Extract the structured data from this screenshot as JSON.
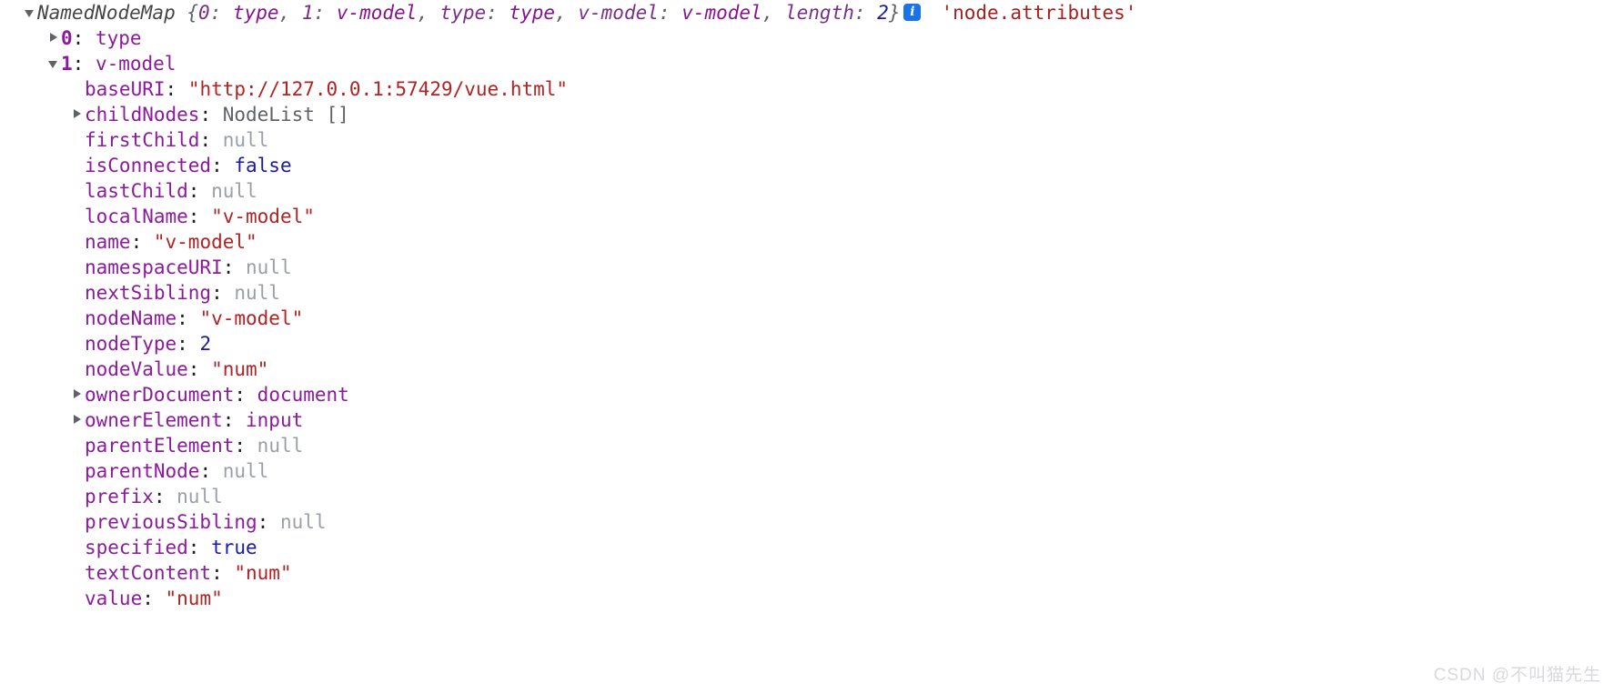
{
  "console": {
    "header": {
      "arrow": "triangle-down",
      "class_name": "NamedNodeMap",
      "brace_open": "{",
      "entries": [
        {
          "key": "0",
          "sep": ": ",
          "value": "type"
        },
        {
          "key": "1",
          "sep": ": ",
          "value": "v-model"
        },
        {
          "key": "type",
          "sep": ": ",
          "value": "type"
        },
        {
          "key": "v-model",
          "sep": ": ",
          "value": "v-model"
        },
        {
          "key": "length",
          "sep": ": ",
          "value": "2",
          "value_type": "number"
        }
      ],
      "brace_close": "}",
      "info_icon": "info-icon",
      "info_glyph": "i",
      "source_label": "'node.attributes'"
    },
    "children": [
      {
        "arrow": "triangle-right",
        "indent": 1,
        "key": "0",
        "key_bold": true,
        "value": "type",
        "value_type": "object"
      },
      {
        "arrow": "triangle-down",
        "indent": 1,
        "key": "1",
        "key_bold": true,
        "value": "v-model",
        "value_type": "object"
      }
    ],
    "properties": [
      {
        "arrow": "none",
        "indent": 2,
        "key": "baseURI",
        "value": "\"http://127.0.0.1:57429/vue.html\"",
        "value_type": "string"
      },
      {
        "arrow": "triangle-right",
        "indent": 2,
        "key": "childNodes",
        "value": "NodeList []",
        "value_type": "nodelist"
      },
      {
        "arrow": "none",
        "indent": 2,
        "key": "firstChild",
        "value": "null",
        "value_type": "null"
      },
      {
        "arrow": "none",
        "indent": 2,
        "key": "isConnected",
        "value": "false",
        "value_type": "boolean"
      },
      {
        "arrow": "none",
        "indent": 2,
        "key": "lastChild",
        "value": "null",
        "value_type": "null"
      },
      {
        "arrow": "none",
        "indent": 2,
        "key": "localName",
        "value": "\"v-model\"",
        "value_type": "string"
      },
      {
        "arrow": "none",
        "indent": 2,
        "key": "name",
        "value": "\"v-model\"",
        "value_type": "string"
      },
      {
        "arrow": "none",
        "indent": 2,
        "key": "namespaceURI",
        "value": "null",
        "value_type": "null"
      },
      {
        "arrow": "none",
        "indent": 2,
        "key": "nextSibling",
        "value": "null",
        "value_type": "null"
      },
      {
        "arrow": "none",
        "indent": 2,
        "key": "nodeName",
        "value": "\"v-model\"",
        "value_type": "string"
      },
      {
        "arrow": "none",
        "indent": 2,
        "key": "nodeType",
        "value": "2",
        "value_type": "number"
      },
      {
        "arrow": "none",
        "indent": 2,
        "key": "nodeValue",
        "value": "\"num\"",
        "value_type": "string"
      },
      {
        "arrow": "triangle-right",
        "indent": 2,
        "key": "ownerDocument",
        "value": "document",
        "value_type": "object"
      },
      {
        "arrow": "triangle-right",
        "indent": 2,
        "key": "ownerElement",
        "value": "input",
        "value_type": "object"
      },
      {
        "arrow": "none",
        "indent": 2,
        "key": "parentElement",
        "value": "null",
        "value_type": "null"
      },
      {
        "arrow": "none",
        "indent": 2,
        "key": "parentNode",
        "value": "null",
        "value_type": "null"
      },
      {
        "arrow": "none",
        "indent": 2,
        "key": "prefix",
        "value": "null",
        "value_type": "null"
      },
      {
        "arrow": "none",
        "indent": 2,
        "key": "previousSibling",
        "value": "null",
        "value_type": "null"
      },
      {
        "arrow": "none",
        "indent": 2,
        "key": "specified",
        "value": "true",
        "value_type": "boolean"
      },
      {
        "arrow": "none",
        "indent": 2,
        "key": "textContent",
        "value": "\"num\"",
        "value_type": "string"
      },
      {
        "arrow": "none",
        "indent": 2,
        "key": "value",
        "value": "\"num\"",
        "value_type": "string"
      }
    ]
  },
  "watermark": "CSDN @不叫猫先生",
  "colors": {
    "background": "#ffffff",
    "property": "#8c1a9e",
    "string": "#b32222",
    "null": "#9aa0a6",
    "boolean": "#1a1aa6",
    "number": "#1a1aa6",
    "class": "#444746",
    "source": "#a52121",
    "info_badge": "#1a73e8",
    "arrow": "#5f6368",
    "watermark": "#d9d9dd"
  }
}
